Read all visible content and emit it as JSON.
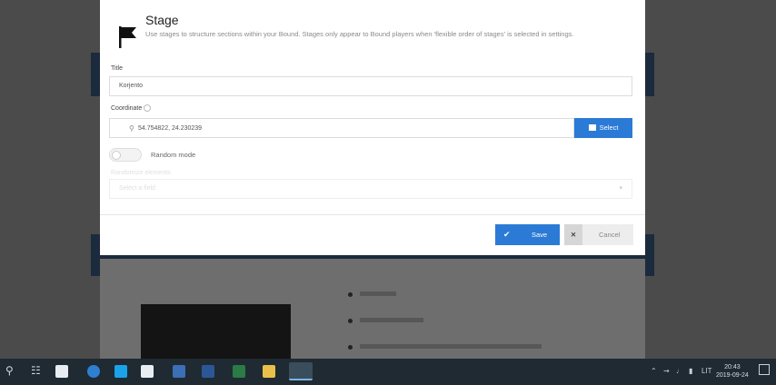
{
  "dialog": {
    "title": "Stage",
    "description": "Use stages to structure sections within your Bound. Stages only appear to Bound players when 'flexible order of stages' is selected in settings.",
    "title_label": "Title",
    "title_value": "Korjento",
    "coordinate_label": "Coordinate",
    "coordinate_value": "54.754822, 24.230239",
    "select_button": "Select",
    "random_mode_label": "Random mode",
    "random_mode_on": false,
    "randomize_label": "Randomize elements",
    "randomize_value": "Select a field",
    "save_button": "Save",
    "cancel_button": "Cancel"
  },
  "taskbar": {
    "time": "20:43",
    "date": "2019-09-24",
    "language": "LIT",
    "apps": [
      "task-view",
      "mail",
      "edge",
      "skype",
      "store",
      "photos",
      "word",
      "excel",
      "file-explorer",
      "chrome"
    ]
  },
  "colors": {
    "accent": "#2b7bd6",
    "overlay": "#5f5f5f",
    "taskbar": "#1f2a33"
  }
}
